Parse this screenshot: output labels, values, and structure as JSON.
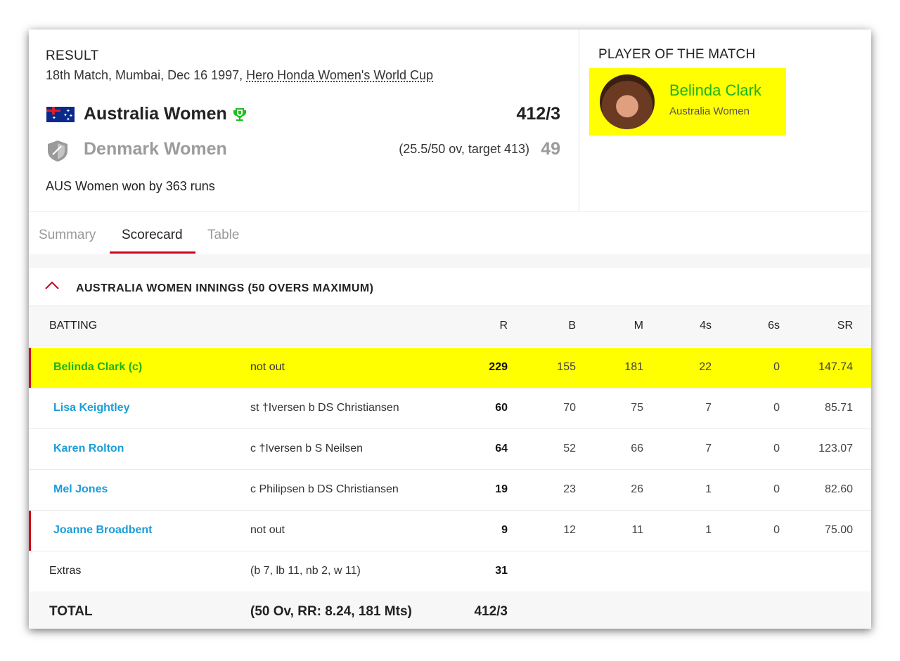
{
  "header": {
    "result_label": "RESULT",
    "match_prefix": "18th Match, Mumbai, Dec 16 1997, ",
    "series_link": "Hero Honda Women's World Cup",
    "teams": [
      {
        "name": "Australia Women",
        "score": "412/3",
        "overs": "",
        "winner": true,
        "flag_icon": "australia-flag-icon"
      },
      {
        "name": "Denmark Women",
        "score": "49",
        "overs": "(25.5/50 ov, target 413)",
        "winner": false,
        "flag_icon": "shield-icon"
      }
    ],
    "result_text": "AUS Women won by 363 runs"
  },
  "player_of_match": {
    "label": "PLAYER OF THE MATCH",
    "name": "Belinda Clark",
    "team": "Australia Women"
  },
  "tabs": [
    {
      "label": "Summary",
      "active": false
    },
    {
      "label": "Scorecard",
      "active": true
    },
    {
      "label": "Table",
      "active": false
    }
  ],
  "innings": {
    "title": "AUSTRALIA WOMEN INNINGS (50 OVERS MAXIMUM)",
    "columns": [
      "BATTING",
      "R",
      "B",
      "M",
      "4s",
      "6s",
      "SR"
    ],
    "batters": [
      {
        "name": "Belinda Clark (c)",
        "dismissal": "not out",
        "R": "229",
        "B": "155",
        "M": "181",
        "4s": "22",
        "6s": "0",
        "SR": "147.74"
      },
      {
        "name": "Lisa Keightley",
        "dismissal": "st †Iversen b DS Christiansen",
        "R": "60",
        "B": "70",
        "M": "75",
        "4s": "7",
        "6s": "0",
        "SR": "85.71"
      },
      {
        "name": "Karen Rolton",
        "dismissal": "c †Iversen b S Neilsen",
        "R": "64",
        "B": "52",
        "M": "66",
        "4s": "7",
        "6s": "0",
        "SR": "123.07"
      },
      {
        "name": "Mel Jones",
        "dismissal": "c Philipsen b DS Christiansen",
        "R": "19",
        "B": "23",
        "M": "26",
        "4s": "1",
        "6s": "0",
        "SR": "82.60"
      },
      {
        "name": "Joanne Broadbent",
        "dismissal": "not out",
        "R": "9",
        "B": "12",
        "M": "11",
        "4s": "1",
        "6s": "0",
        "SR": "75.00"
      }
    ],
    "extras": {
      "label": "Extras",
      "detail": "(b 7, lb 11, nb 2, w 11)",
      "runs": "31"
    },
    "total": {
      "label": "TOTAL",
      "detail": "(50 Ov, RR: 8.24, 181 Mts)",
      "runs": "412/3"
    }
  },
  "colors": {
    "highlight": "#ffff00",
    "accent_red": "#d0021b",
    "link_blue": "#1a9ed8",
    "pom_green": "#1bb31b"
  }
}
